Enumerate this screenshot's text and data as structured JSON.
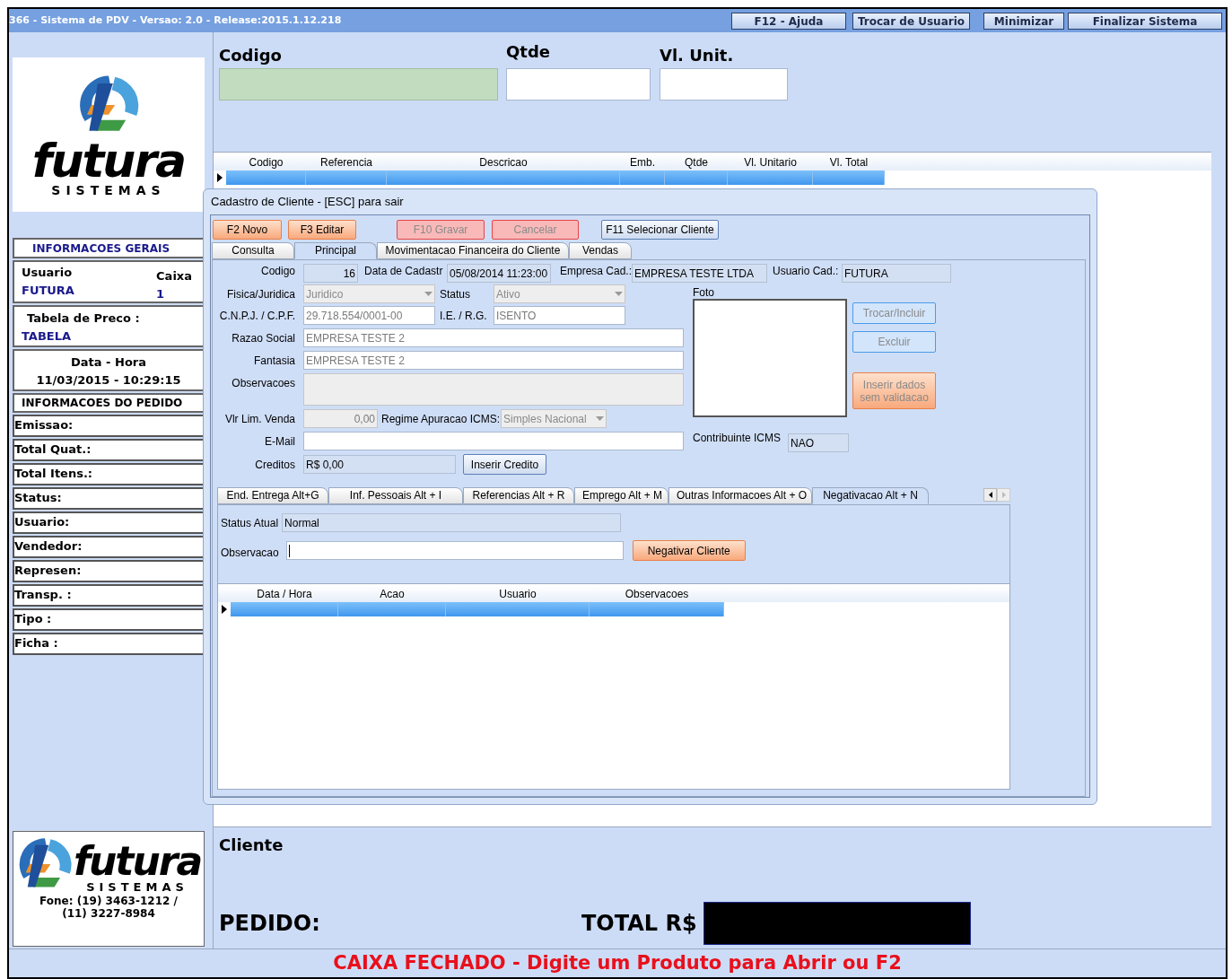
{
  "window": {
    "title": "366 - Sistema de PDV - Versao: 2.0 - Release:2015.1.12.218",
    "buttons": [
      "F12 - Ajuda",
      "Trocar de Usuario",
      "Minimizar",
      "Finalizar Sistema"
    ]
  },
  "logo": {
    "word": "futura",
    "tagline": "SISTEMAS"
  },
  "general_info": {
    "header": "INFORMACOES GERAIS",
    "user_label": "Usuario",
    "user_value": "FUTURA",
    "cash_label": "Caixa",
    "cash_value": "1",
    "price_table_label": "Tabela de Preco :",
    "price_table_value": "TABELA",
    "datetime_label": "Data - Hora",
    "datetime_value": "11/03/2015 - 10:29:15"
  },
  "order_info": {
    "header": "INFORMACOES DO PEDIDO",
    "fields": [
      "Emissao:",
      "Total Quat.:",
      "Total Itens.:",
      "Status:",
      "Usuario:",
      "Vendedor:",
      "Represen:",
      "Transp. :",
      "Tipo :",
      "Ficha :"
    ]
  },
  "footer_logo": {
    "word": "futura",
    "tagline": "SISTEMAS",
    "phone": "Fone: (19) 3463-1212 / (11) 3227-8984"
  },
  "entry": [
    {
      "label": "Codigo",
      "kind": "code"
    },
    {
      "label": "Qtde",
      "kind": "plain"
    },
    {
      "label": "Vl. Unit.",
      "kind": "plain"
    }
  ],
  "items_table": {
    "columns": [
      "Codigo",
      "Referencia",
      "Descricao",
      "Emb.",
      "Qtde",
      "Vl. Unitario",
      "Vl. Total"
    ],
    "rows": [
      {
        "selected": true
      }
    ]
  },
  "summary": {
    "client_label": "Cliente",
    "order_label": "PEDIDO:",
    "total_label": "TOTAL R$"
  },
  "status_message": "CAIXA FECHADO - Digite um Produto para Abrir ou F2",
  "dialog": {
    "title": "Cadastro de Cliente - [ESC] para sair",
    "toolbar": [
      {
        "label": "F2 Novo",
        "kind": "accent",
        "disabled": false
      },
      {
        "label": "F3 Editar",
        "kind": "accent",
        "disabled": false
      },
      {
        "label": "F10 Gravar",
        "kind": "danger",
        "disabled": true
      },
      {
        "label": "Cancelar",
        "kind": "danger",
        "disabled": true
      },
      {
        "label": "F11 Selecionar Cliente",
        "kind": "plain",
        "disabled": false
      }
    ],
    "tabs": [
      {
        "label": "Consulta",
        "selected": false
      },
      {
        "label": "Principal",
        "selected": true
      },
      {
        "label": "Movimentacao Financeira do Cliente",
        "selected": false
      },
      {
        "label": "Vendas",
        "selected": false
      }
    ],
    "fields": {
      "codigo": {
        "label": "Codigo",
        "value": "16",
        "kind": "readonly"
      },
      "data_cadastro": {
        "label": "Data de Cadastr",
        "value": "05/08/2014 11:23:00",
        "kind": "readonly"
      },
      "empresa_cad": {
        "label": "Empresa Cad.:",
        "value": "EMPRESA TESTE LTDA",
        "kind": "readonly"
      },
      "usuario_cad": {
        "label": "Usuario Cad.:",
        "value": "FUTURA",
        "kind": "readonly"
      },
      "fisica_juridica": {
        "label": "Fisica/Juridica",
        "value": "Juridico",
        "kind": "select"
      },
      "status": {
        "label": "Status",
        "value": "Ativo",
        "kind": "select"
      },
      "cnpj_cpf": {
        "label": "C.N.P.J. / C.P.F.",
        "value": "29.718.554/0001-00",
        "kind": "input"
      },
      "ie_rg": {
        "label": "I.E. / R.G.",
        "value": "ISENTO",
        "kind": "input"
      },
      "razao_social": {
        "label": "Razao Social",
        "value": "EMPRESA TESTE 2",
        "kind": "input"
      },
      "fantasia": {
        "label": "Fantasia",
        "value": "EMPRESA TESTE 2",
        "kind": "input"
      },
      "observacoes": {
        "label": "Observacoes",
        "kind": "disabled"
      },
      "vlr_lim_venda": {
        "label": "Vlr Lim. Venda",
        "value": "0,00",
        "kind": "disabled"
      },
      "regime_icms": {
        "label": "Regime Apuracao ICMS:",
        "value": "Simples Nacional",
        "kind": "select"
      },
      "email": {
        "label": "E-Mail",
        "kind": "input"
      },
      "creditos": {
        "label": "Creditos",
        "value": "R$ 0,00",
        "kind": "readonly"
      },
      "contribuinte_icms": {
        "label": "Contribuinte ICMS",
        "value": "NAO",
        "kind": "readonly"
      }
    },
    "credit_button": {
      "label": "Inserir Credito",
      "kind": "plain",
      "disabled": false
    },
    "photo": {
      "label": "Foto",
      "buttons": [
        {
          "label": "Trocar/Incluir",
          "kind": "info",
          "disabled": true
        },
        {
          "label": "Excluir",
          "kind": "info",
          "disabled": true
        },
        {
          "label": "Inserir dados sem validacao",
          "kind": "accent",
          "disabled": true
        }
      ]
    },
    "subtabs": [
      {
        "label": "End. Entrega Alt+G",
        "selected": false
      },
      {
        "label": "Inf. Pessoais Alt + I",
        "selected": false
      },
      {
        "label": "Referencias Alt + R",
        "selected": false
      },
      {
        "label": "Emprego Alt + M",
        "selected": false
      },
      {
        "label": "Outras Informacoes Alt + O",
        "selected": false
      },
      {
        "label": "Negativacao Alt + N",
        "selected": true
      }
    ],
    "negativacao": {
      "status_label": "Status Atual",
      "status_value": "Normal",
      "obs_label": "Observacao",
      "button": {
        "label": "Negativar Cliente",
        "kind": "accent",
        "disabled": false
      },
      "table": {
        "columns": [
          "Data / Hora",
          "Acao",
          "Usuario",
          "Observacoes"
        ],
        "rows": [
          {
            "selected": true
          }
        ]
      }
    }
  }
}
